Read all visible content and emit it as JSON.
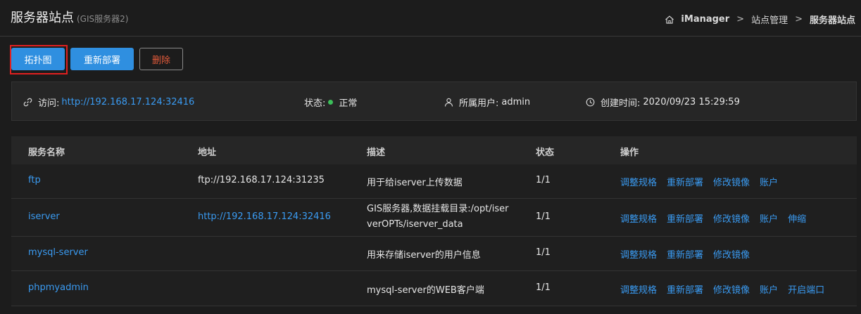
{
  "header": {
    "title": "服务器站点",
    "subtitle": "(GIS服务器2)",
    "breadcrumb": [
      "iManager",
      "站点管理",
      "服务器站点"
    ]
  },
  "toolbar": {
    "topology_label": "拓扑图",
    "redeploy_label": "重新部署",
    "delete_label": "删除"
  },
  "info": {
    "access_label": "访问:",
    "access_url": "http://192.168.17.124:32416",
    "status_label": "状态:",
    "status_value": "正常",
    "owner_label": "所属用户:",
    "owner_value": "admin",
    "created_label": "创建时间:",
    "created_value": "2020/09/23 15:29:59"
  },
  "table": {
    "headers": [
      "服务名称",
      "地址",
      "描述",
      "状态",
      "操作"
    ],
    "rows": [
      {
        "name": "ftp",
        "address": "ftp://192.168.17.124:31235",
        "desc": "用于给iserver上传数据",
        "status": "1/1",
        "ops": [
          "调整规格",
          "重新部署",
          "修改镜像",
          "账户"
        ]
      },
      {
        "name": "iserver",
        "address": "http://192.168.17.124:32416",
        "desc_line1": "GIS服务器,数据挂载目录:/opt/iser",
        "desc_line2": "verOPTs/iserver_data",
        "status": "1/1",
        "ops": [
          "调整规格",
          "重新部署",
          "修改镜像",
          "账户",
          "伸缩"
        ]
      },
      {
        "name": "mysql-server",
        "address": "",
        "desc": "用来存储iserver的用户信息",
        "status": "1/1",
        "ops": [
          "调整规格",
          "重新部署",
          "修改镜像"
        ]
      },
      {
        "name": "phpmyadmin",
        "address": "",
        "desc": "mysql-server的WEB客户端",
        "status": "1/1",
        "ops": [
          "调整规格",
          "重新部署",
          "修改镜像",
          "账户",
          "开启端口"
        ]
      }
    ]
  },
  "colors": {
    "accent": "#2f8fe0",
    "link": "#3a9bf2",
    "danger": "#e25a3a",
    "status_ok": "#3cbf5a"
  }
}
